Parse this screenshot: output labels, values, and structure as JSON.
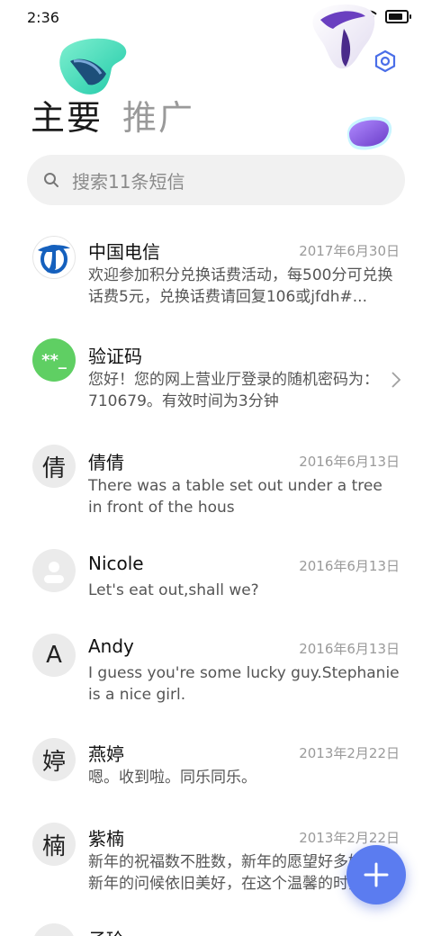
{
  "status_bar": {
    "time": "2:36",
    "battery_level": 0.85
  },
  "tabs": [
    {
      "label": "主要"
    },
    {
      "label": "推广"
    }
  ],
  "search": {
    "placeholder": "搜索11条短信"
  },
  "conversations": [
    {
      "name": "中国电信",
      "date": "2017年6月30日",
      "preview": "欢迎参加积分兑换话费活动，每500分可兑换话费5元，兑换话费请回复106或jfdh#...",
      "avatar_type": "logo",
      "avatar_color": "#1560bd"
    },
    {
      "name": "验证码",
      "date": "",
      "preview": "您好！您的网上营业厅登录的随机密码为：710679。有效时间为3分钟",
      "avatar_text": "**_",
      "avatar_color": "#5fcf63"
    },
    {
      "name": "倩倩",
      "date": "2016年6月13日",
      "preview": "There was a table set out under a tree in front of the hous",
      "avatar_text": "倩"
    },
    {
      "name": "Nicole",
      "date": "2016年6月13日",
      "preview": "Let's eat out,shall we?",
      "avatar_type": "person-icon"
    },
    {
      "name": "Andy",
      "date": "2016年6月13日",
      "preview": "I guess you're some lucky guy.Stephanie is a nice girl.",
      "avatar_text": "A"
    },
    {
      "name": "燕婷",
      "date": "2013年2月22日",
      "preview": "嗯。收到啦。同乐同乐。",
      "avatar_text": "婷"
    },
    {
      "name": "紫楠",
      "date": "2013年2月22日",
      "preview": "新年的祝福数不胜数，新年的愿望好多好多，新年的问候依旧美好，在这个温馨的时刻",
      "avatar_text": "楠"
    },
    {
      "name": "子玲",
      "date": "",
      "preview": "",
      "avatar_text": ""
    }
  ],
  "icons": {
    "search": "search-icon",
    "settings": "hexagon-settings-icon",
    "compose": "plus-icon",
    "chevron": "chevron-right-icon"
  },
  "colors": {
    "accent": "#5b7cf0",
    "fab": "#5b7cf0"
  }
}
